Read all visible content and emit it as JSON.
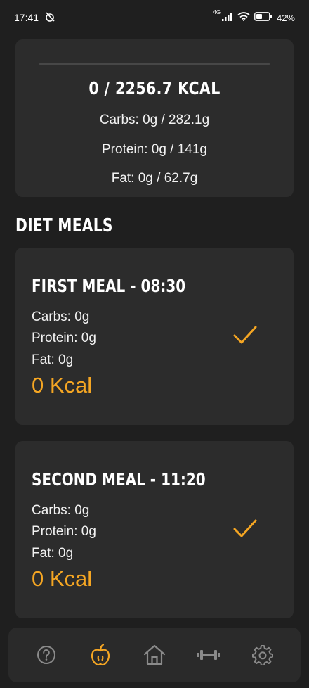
{
  "status_bar": {
    "time": "17:41",
    "network": "4G",
    "battery": "42%"
  },
  "summary": {
    "kcal_total": "0 / 2256.7 KCAL",
    "kcal_progress": 0,
    "carbs": "Carbs: 0g / 282.1g",
    "protein": "Protein: 0g / 141g",
    "fat": "Fat: 0g / 62.7g"
  },
  "section_title": "DIET MEALS",
  "meals": [
    {
      "title": "FIRST MEAL - 08:30",
      "carbs": "Carbs: 0g",
      "protein": "Protein: 0g",
      "fat": "Fat: 0g",
      "kcal": "0 Kcal",
      "checked": true
    },
    {
      "title": "SECOND MEAL - 11:20",
      "carbs": "Carbs: 0g",
      "protein": "Protein: 0g",
      "fat": "Fat: 0g",
      "kcal": "0 Kcal",
      "checked": true
    }
  ],
  "nav": {
    "items": [
      "help-icon",
      "apple-icon",
      "home-icon",
      "dumbbell-icon",
      "settings-icon"
    ],
    "active": "apple-icon"
  },
  "colors": {
    "accent": "#f5a623",
    "background": "#1f1f1f",
    "card": "#2c2c2c",
    "icon_inactive": "#8a8a8a"
  }
}
